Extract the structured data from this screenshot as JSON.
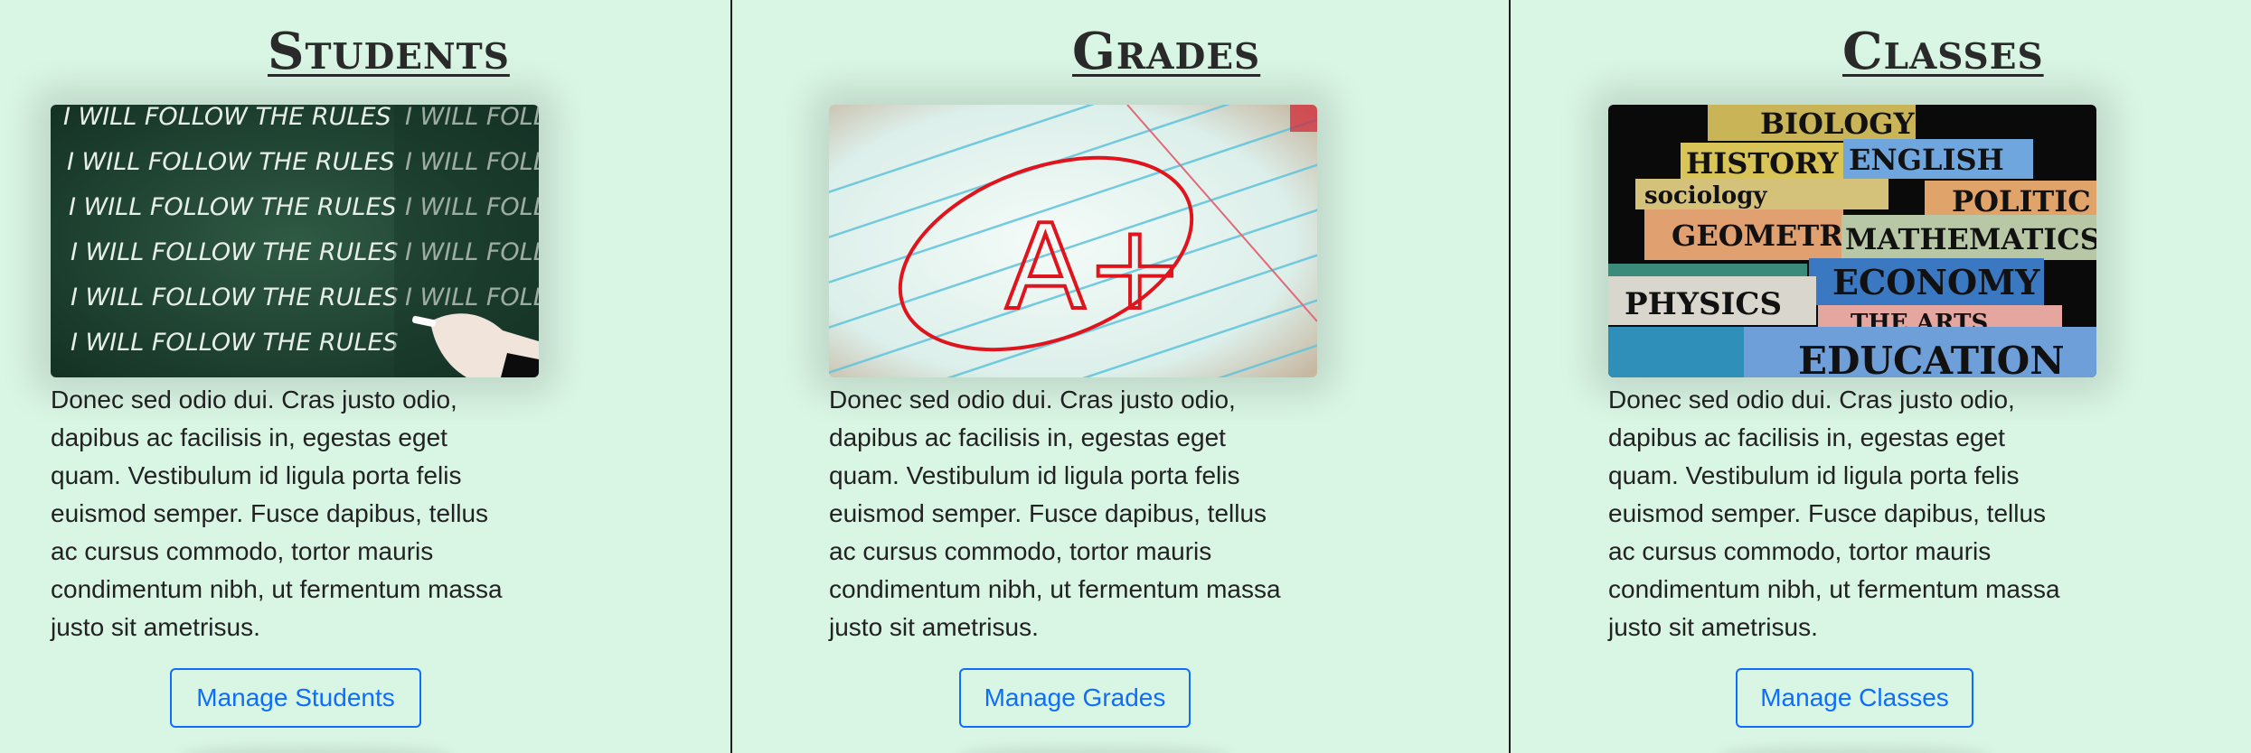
{
  "sections": [
    {
      "title": "Students",
      "image_icon": "chalkboard-image",
      "chalk_line": "I WILL FOLLOW THE RULES",
      "description_lines": [
        "Donec sed odio dui. Cras justo odio,",
        "dapibus ac facilisis in, egestas eget",
        "quam. Vestibulum id ligula porta felis",
        "euismod semper. Fusce dapibus, tellus",
        "ac cursus commodo, tortor mauris",
        "condimentum nibh, ut fermentum massa",
        "justo sit ametrisus."
      ],
      "button_label": "Manage Students"
    },
    {
      "title": "Grades",
      "image_icon": "grade-paper-image",
      "grade_mark": "A+",
      "description_lines": [
        "Donec sed odio dui. Cras justo odio,",
        "dapibus ac facilisis in, egestas eget",
        "quam. Vestibulum id ligula porta felis",
        "euismod semper. Fusce dapibus, tellus",
        "ac cursus commodo, tortor mauris",
        "condimentum nibh, ut fermentum massa",
        "justo sit ametrisus."
      ],
      "button_label": "Manage Grades"
    },
    {
      "title": "Classes",
      "image_icon": "book-stack-image",
      "book_spines": [
        "BIOLOGY",
        "HISTORY",
        "ENGLISH",
        "sociology",
        "POLITIC",
        "GEOMETR",
        "MATHEMATICS",
        "ECONOMY",
        "PHYSICS",
        "THE ARTS",
        "EDUCATION"
      ],
      "description_lines": [
        "Donec sed odio dui. Cras justo odio,",
        "dapibus ac facilisis in, egestas eget",
        "quam. Vestibulum id ligula porta felis",
        "euismod semper. Fusce dapibus, tellus",
        "ac cursus commodo, tortor mauris",
        "condimentum nibh, ut fermentum massa",
        "justo sit ametrisus."
      ],
      "button_label": "Manage Classes"
    }
  ],
  "colors": {
    "background": "#d9f5e4",
    "button_accent": "#0d6efd",
    "divider": "#1e1e1e"
  }
}
